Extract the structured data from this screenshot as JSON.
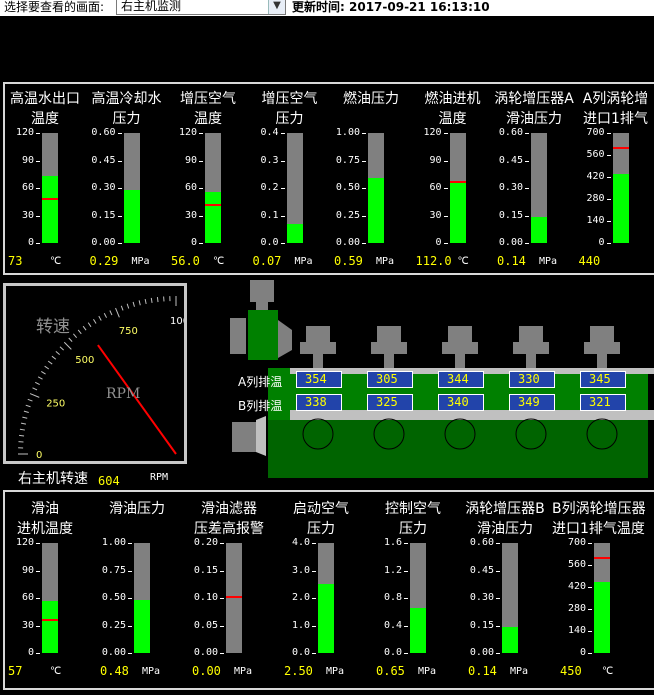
{
  "topbar": {
    "select_label": "选择要查看的画面:",
    "selected_screen": "右主机监测",
    "update_label": "更新时间:",
    "update_time": "2017-09-21 16:13:10"
  },
  "top_gauges": [
    {
      "title1": "高温水出口",
      "title2": "温度",
      "ticks": [
        "120",
        "90",
        "60",
        "30",
        "0"
      ],
      "value": "73",
      "unit": "℃",
      "fill": 0.608,
      "alarm": 0.39
    },
    {
      "title1": "高温冷却水",
      "title2": "压力",
      "ticks": [
        "0.60",
        "0.45",
        "0.30",
        "0.15",
        "0.00"
      ],
      "value": "0.29",
      "unit": "MPa",
      "fill": 0.483,
      "alarm": null
    },
    {
      "title1": "增压空气",
      "title2": "温度",
      "ticks": [
        "120",
        "90",
        "60",
        "30",
        "0"
      ],
      "value": "56.0",
      "unit": "℃",
      "fill": 0.467,
      "alarm": 0.34
    },
    {
      "title1": "增压空气",
      "title2": "压力",
      "ticks": [
        "0.4",
        "0.3",
        "0.2",
        "0.1",
        "0.0"
      ],
      "value": "0.07",
      "unit": "MPa",
      "fill": 0.175,
      "alarm": null
    },
    {
      "title1": "燃油压力",
      "title2": "",
      "ticks": [
        "1.00",
        "0.75",
        "0.50",
        "0.25",
        "0.00"
      ],
      "value": "0.59",
      "unit": "MPa",
      "fill": 0.59,
      "alarm": null
    },
    {
      "title1": "燃油进机",
      "title2": "温度",
      "ticks": [
        "120",
        "90",
        "60",
        "30",
        "0"
      ],
      "value": "112.0",
      "unit": "℃",
      "fill": 0.545,
      "alarm": 0.545
    },
    {
      "title1": "涡轮增压器A",
      "title2": "滑油压力",
      "ticks": [
        "0.60",
        "0.45",
        "0.30",
        "0.15",
        "0.00"
      ],
      "value": "0.14",
      "unit": "MPa",
      "fill": 0.233,
      "alarm": null
    },
    {
      "title1": "A列涡轮增",
      "title2": "进口1排气",
      "ticks": [
        "700",
        "560",
        "420",
        "280",
        "140",
        "0"
      ],
      "value": "440",
      "unit": "",
      "fill": 0.629,
      "alarm": 0.857
    }
  ],
  "bottom_gauges": [
    {
      "title1": "滑油",
      "title2": "进机温度",
      "ticks": [
        "120",
        "90",
        "60",
        "30",
        "0"
      ],
      "value": "57",
      "unit": "℃",
      "fill": 0.475,
      "alarm": 0.29
    },
    {
      "title1": "滑油压力",
      "title2": "",
      "ticks": [
        "1.00",
        "0.75",
        "0.50",
        "0.25",
        "0.00"
      ],
      "value": "0.48",
      "unit": "MPa",
      "fill": 0.48,
      "alarm": null
    },
    {
      "title1": "滑油滤器",
      "title2": "压差高报警",
      "ticks": [
        "0.20",
        "0.15",
        "0.10",
        "0.05",
        "0.00"
      ],
      "value": "0.00",
      "unit": "MPa",
      "fill": 0.0,
      "alarm": 0.5
    },
    {
      "title1": "启动空气",
      "title2": "压力",
      "ticks": [
        "4.0",
        "3.0",
        "2.0",
        "1.0",
        "0.0"
      ],
      "value": "2.50",
      "unit": "MPa",
      "fill": 0.625,
      "alarm": null
    },
    {
      "title1": "控制空气",
      "title2": "压力",
      "ticks": [
        "1.6",
        "1.2",
        "0.8",
        "0.4",
        "0.0"
      ],
      "value": "0.65",
      "unit": "MPa",
      "fill": 0.406,
      "alarm": null
    },
    {
      "title1": "涡轮增压器B",
      "title2": "滑油压力",
      "ticks": [
        "0.60",
        "0.45",
        "0.30",
        "0.15",
        "0.00"
      ],
      "value": "0.14",
      "unit": "MPa",
      "fill": 0.233,
      "alarm": null
    },
    {
      "title1": "B列涡轮增压器",
      "title2": "进口1排气温度",
      "ticks": [
        "700",
        "560",
        "420",
        "280",
        "140",
        "0"
      ],
      "value": "450",
      "unit": "℃",
      "fill": 0.643,
      "alarm": 0.857
    }
  ],
  "speed_gauge": {
    "title": "转速",
    "unit_center": "RPM",
    "ticks": [
      "0",
      "250",
      "500",
      "750",
      "1000"
    ],
    "caption": "右主机转速",
    "value": "604",
    "unit": "RPM",
    "rpm": 604,
    "max": 1000
  },
  "engine": {
    "row_a_label": "A列排温",
    "row_b_label": "B列排温",
    "row_a": [
      "354",
      "305",
      "344",
      "330",
      "345"
    ],
    "row_b": [
      "338",
      "325",
      "340",
      "349",
      "321"
    ]
  },
  "colors": {
    "fill": "#00ff00",
    "alarm": "#ff0000",
    "bar": "#808080",
    "value": "#ffff00",
    "engine": "#008000",
    "cell": "#2244aa"
  }
}
